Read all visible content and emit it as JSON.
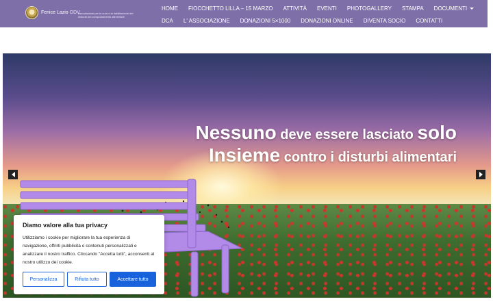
{
  "header": {
    "logo_name": "Fenice Lazio",
    "logo_suffix": "ODV",
    "logo_tagline": "associazione per la cura e la riabilitazione dei disturbi del comportamento alimentare",
    "nav_row1": [
      {
        "label": "HOME"
      },
      {
        "label": "FIOCCHETTO LILLA – 15 MARZO"
      },
      {
        "label": "ATTIVITÀ"
      },
      {
        "label": "EVENTI"
      },
      {
        "label": "PHOTOGALLERY"
      },
      {
        "label": "STAMPA"
      },
      {
        "label": "DOCUMENTI"
      }
    ],
    "nav_row2": [
      {
        "label": "DCA"
      },
      {
        "label": "L' ASSOCIAZIONE"
      },
      {
        "label": "DONAZIONI 5×1000"
      },
      {
        "label": "DONAZIONI ONLINE"
      },
      {
        "label": "DIVENTA SOCIO"
      },
      {
        "label": "CONTATTI"
      }
    ]
  },
  "hero": {
    "line1_big": "Nessuno",
    "line1_small": " deve essere lasciato ",
    "line1_big2": "solo",
    "line2_big": "Insieme",
    "line2_small": " contro i disturbi alimentari"
  },
  "cookie": {
    "title": "Diamo valore alla tua privacy",
    "text": "Utilizziamo i cookie per migliorare la tua esperienza di navigazione, offrirti pubblicità o contenuti personalizzati e analizzare il nostro traffico. Cliccando \"Accetta tutti\", acconsenti al nostro utilizzo dei cookie.",
    "btn_customize": "Personalizza",
    "btn_reject": "Rifiuta tutto",
    "btn_accept": "Accettare tutto"
  },
  "colors": {
    "header_bg": "#7f6fa8",
    "accent_blue": "#1863dc",
    "bench": "#a77ee0"
  }
}
